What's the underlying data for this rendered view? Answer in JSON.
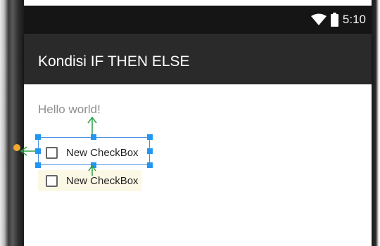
{
  "status_bar": {
    "time": "5:10",
    "icons": [
      "wifi-icon",
      "battery-icon"
    ]
  },
  "action_bar": {
    "title": "Kondisi IF THEN ELSE"
  },
  "content": {
    "hello_text": "Hello world!",
    "checkboxes": [
      {
        "label": "New CheckBox",
        "checked": false,
        "selected_in_editor": true
      },
      {
        "label": "New CheckBox",
        "checked": false,
        "selected_in_editor": false
      }
    ]
  },
  "colors": {
    "status_bar": "#151515",
    "action_bar": "#2a2a2a",
    "selection": "#2196f3",
    "constraint_arrow": "#2ea043",
    "anchor_dot": "#f0a830"
  }
}
